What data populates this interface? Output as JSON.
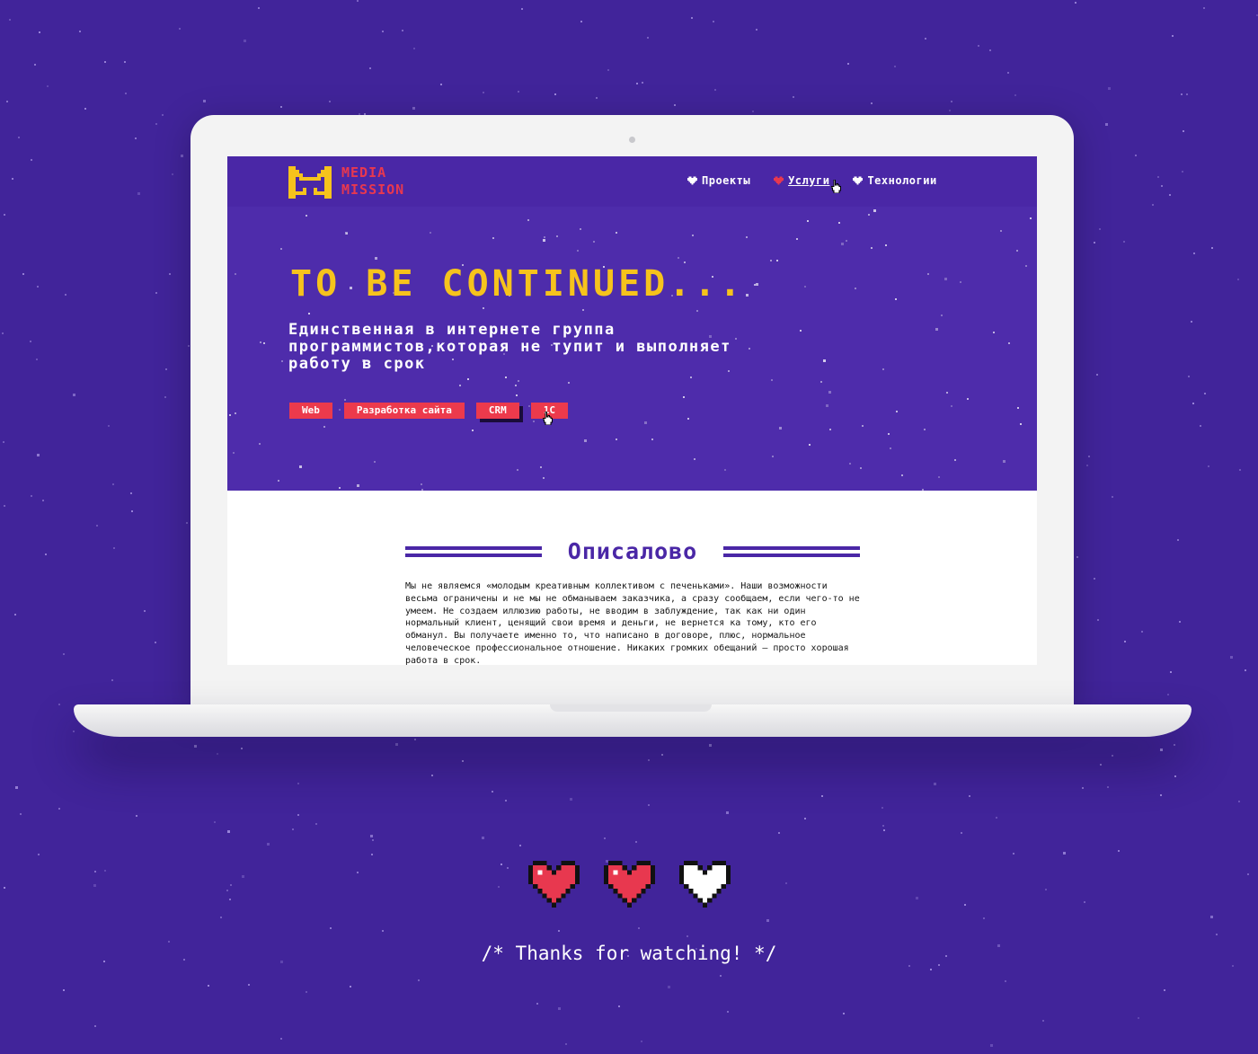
{
  "colors": {
    "background": "#41249a",
    "header": "#4a27a6",
    "hero": "#4e2cab",
    "accent_yellow": "#f6c31c",
    "accent_red": "#ec3a4c",
    "heart_red": "#e8384f"
  },
  "logo": {
    "icon": "pixel-m-cat-logo-icon",
    "line1": "MEDIA",
    "line2": "MISSION"
  },
  "nav": [
    {
      "label": "Проекты",
      "icon": "pixel-heart-white-icon"
    },
    {
      "label": "Услуги",
      "icon": "pixel-heart-red-icon"
    },
    {
      "label": "Технологии",
      "icon": "pixel-heart-white-icon"
    }
  ],
  "hero": {
    "title": "TO BE CONTINUED...",
    "text": "Единственная в интернете группа программистов,которая не тупит и выполняет работу в срок",
    "tags": [
      "Web",
      "Разработка сайта",
      "CRM",
      "1C"
    ]
  },
  "section": {
    "title": "Описалово",
    "body": "Мы не являемся «молодым креативным коллективом с печеньками». Наши возможности весьма ограничены и не мы не обманываем заказчика, а сразу сообщаем, если чего-то не умеем. Не создаем иллюзию работы, не вводим в заблуждение, так как ни один нормальный клиент, ценящий свои время и деньги, не вернется ка тому, кто его обманул. Вы получаете именно то, что написано в договоре, плюс, нормальное человеческое профессиональное отношение. Никаких громких обещаний – просто хорошая работа в срок."
  },
  "lives": {
    "filled": 2,
    "total": 3,
    "icons": [
      "pixel-heart-red-icon",
      "pixel-heart-red-icon",
      "pixel-heart-white-icon"
    ]
  },
  "footer": {
    "thanks": "/* Thanks for watching! */"
  }
}
